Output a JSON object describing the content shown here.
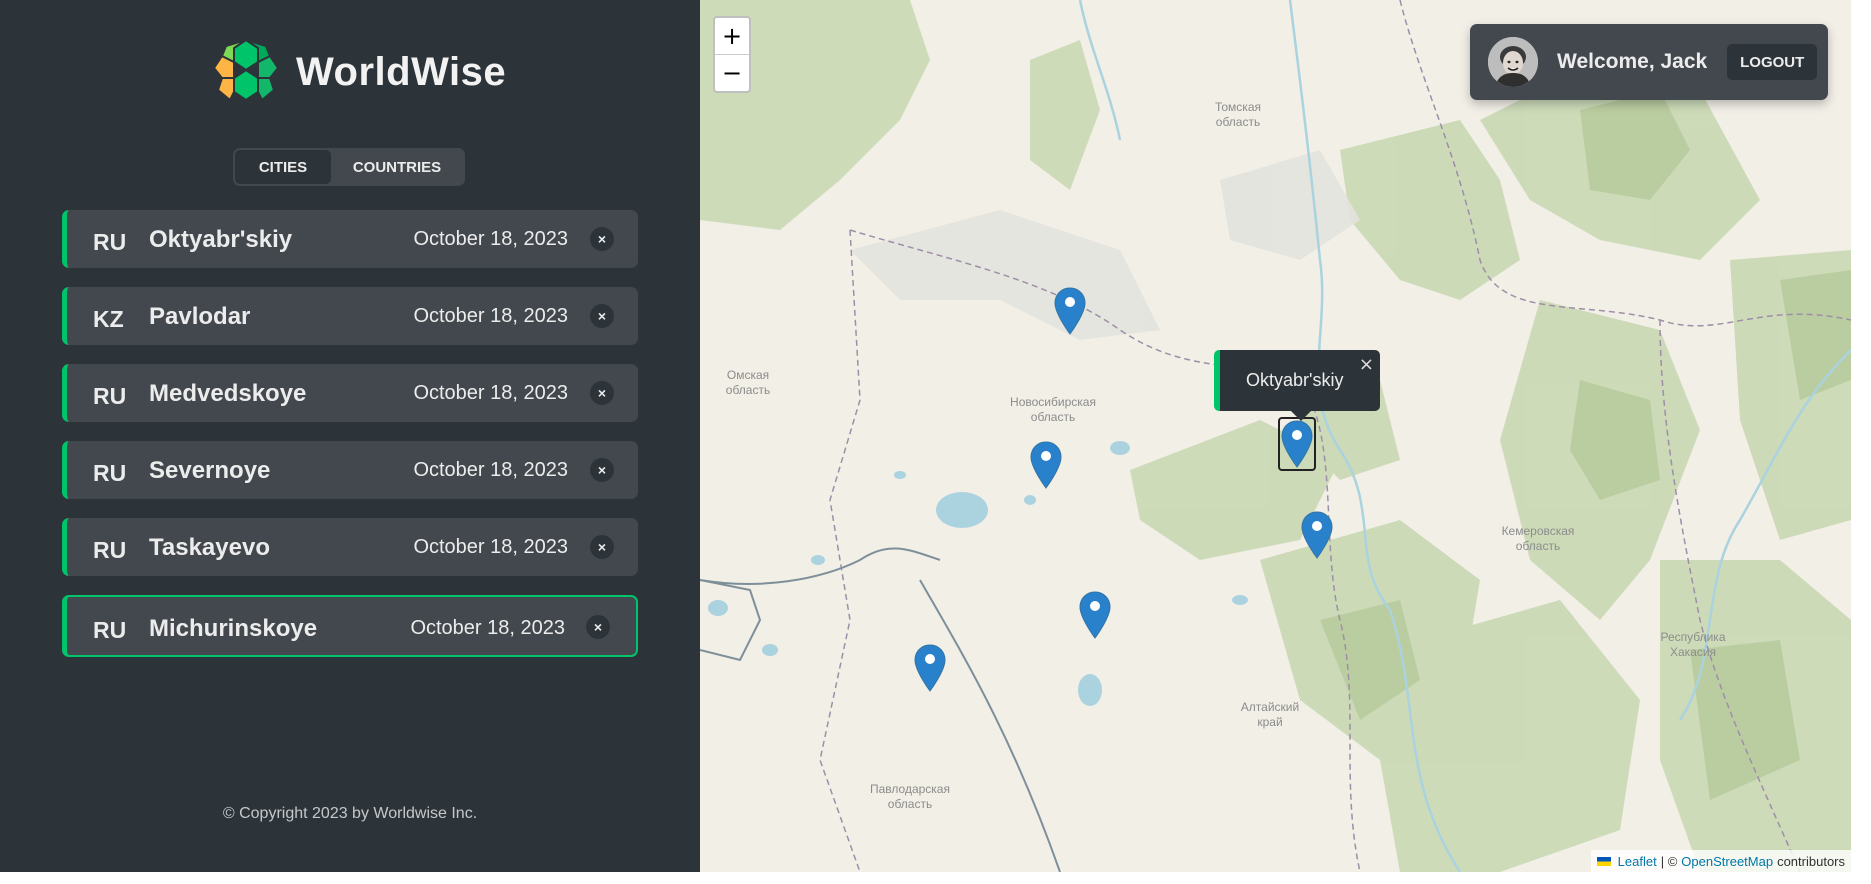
{
  "app": {
    "name": "WorldWise"
  },
  "tabs": [
    {
      "label": "CITIES",
      "active": true
    },
    {
      "label": "COUNTRIES",
      "active": false
    }
  ],
  "cities": [
    {
      "flag": "RU",
      "name": "Oktyabr'skiy",
      "date": "October 18, 2023",
      "delete": "×"
    },
    {
      "flag": "KZ",
      "name": "Pavlodar",
      "date": "October 18, 2023",
      "delete": "×"
    },
    {
      "flag": "RU",
      "name": "Medvedskoye",
      "date": "October 18, 2023",
      "delete": "×"
    },
    {
      "flag": "RU",
      "name": "Severnoye",
      "date": "October 18, 2023",
      "delete": "×"
    },
    {
      "flag": "RU",
      "name": "Taskayevo",
      "date": "October 18, 2023",
      "delete": "×"
    },
    {
      "flag": "RU",
      "name": "Michurinskoye",
      "date": "October 18, 2023",
      "delete": "×",
      "selected": true
    }
  ],
  "footer": {
    "copyright": "© Copyright 2023 by Worldwise Inc."
  },
  "map": {
    "zoom_in": "+",
    "zoom_out": "−",
    "user": {
      "welcome": "Welcome, Jack",
      "logout": "LOGOUT"
    },
    "popup": {
      "text": "Oktyabr'skiy",
      "close": "×"
    },
    "labels": {
      "tomsk": "Томская область",
      "omsk": "Омская область",
      "novosibirsk": "Новосибирская область",
      "kemerovo": "Кемеровская область",
      "khakasia": "Республика Хакасия",
      "altai": "Алтайский край",
      "pavlodar": "Павлодарская область"
    },
    "attribution": {
      "leaflet": "Leaflet",
      "sep": "| ©",
      "osm": "OpenStreetMap",
      "contributors": "contributors"
    }
  },
  "colors": {
    "accent": "#00c46a",
    "sidebar_bg": "#2d3439",
    "panel_bg": "#42484d",
    "marker": "#2a81cb"
  }
}
